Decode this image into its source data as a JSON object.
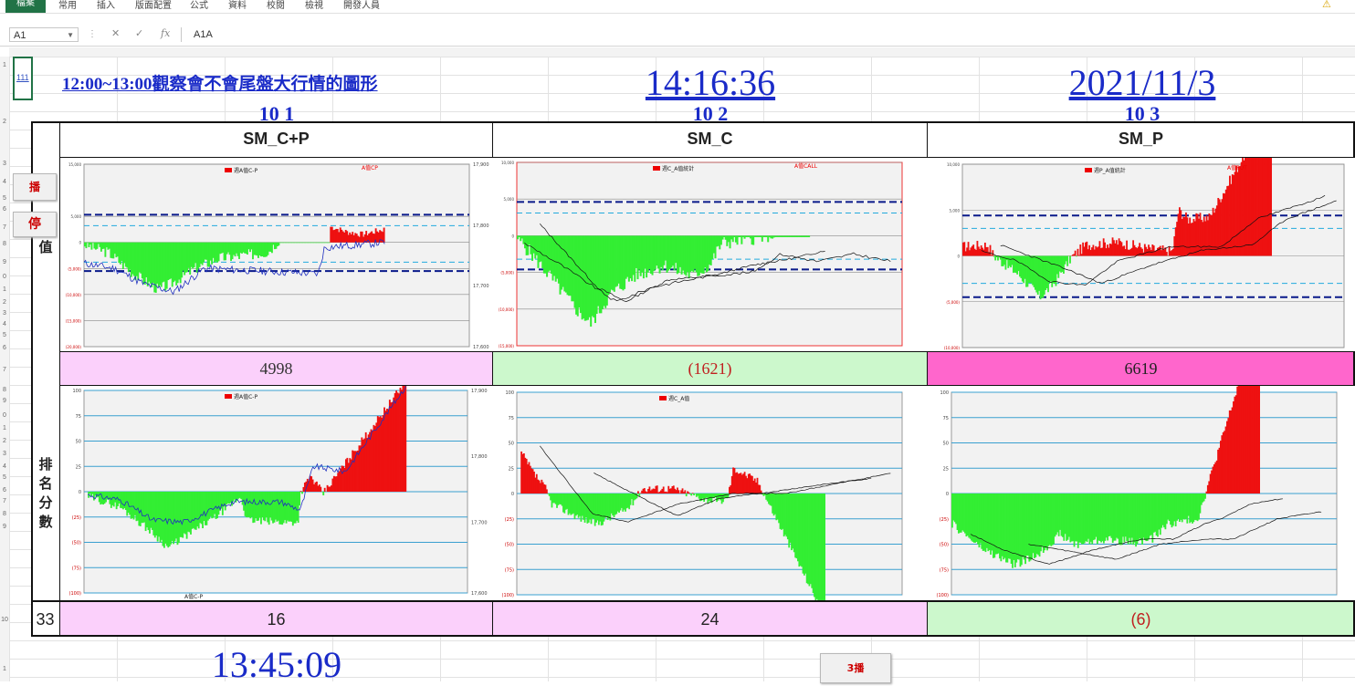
{
  "ribbon": {
    "tabs": [
      "檔案",
      "常用",
      "插入",
      "版面配置",
      "公式",
      "資料",
      "校閱",
      "檢視",
      "開發人員"
    ]
  },
  "formula_bar": {
    "name_box": "A1",
    "formula": "A1A"
  },
  "sheet": {
    "selected_cell_text": "111",
    "title": "12:00~13:00觀察會不會尾盤大行情的圖形",
    "time_top": "14:16:36",
    "date_top": "2021/11/3",
    "time_bottom": "13:45:09",
    "col_numbers": [
      "10 1",
      "10 2",
      "10 3"
    ],
    "headers": [
      "SM_C+P",
      "SM_C",
      "SM_P"
    ],
    "value_label": "值",
    "rank_label": "排名分數",
    "values": [
      "4998",
      "(1621)",
      "6619"
    ],
    "rank_index": "33",
    "ranks": [
      "16",
      "24",
      "(6)"
    ],
    "buttons": {
      "play": "播",
      "stop": "停",
      "play3": "3播"
    }
  },
  "colors": {
    "excel_green": "#217346",
    "link_blue": "#1a2bc8",
    "green_fill": "#33ee33",
    "red_fill": "#ee1111"
  },
  "charts": {
    "top": [
      {
        "legend": "週A值C-P",
        "tag": "A值CP",
        "left_ticks": [
          "15,000",
          "5,000",
          "0",
          "(5,000)",
          "(10,000)",
          "(15,000)",
          "(20,000)"
        ],
        "right_ticks": [
          "17,900",
          "17,800",
          "17,700",
          "17,600"
        ]
      },
      {
        "legend": "週C_A值統計",
        "tag": "A值CALL",
        "left_ticks": [
          "10,000",
          "5,000",
          "0",
          "(5,000)",
          "(10,000)",
          "(15,000)"
        ]
      },
      {
        "legend": "週P_A值統計",
        "tag": "A值PUT",
        "left_ticks": [
          "10,000",
          "5,000",
          "0",
          "(5,000)",
          "(10,000)"
        ]
      }
    ],
    "bottom": [
      {
        "legend": "週A值C-P",
        "xlabel": "A值C-P",
        "left_ticks": [
          "100",
          "75",
          "50",
          "25",
          "0",
          "(25)",
          "(50)",
          "(75)",
          "(100)"
        ],
        "right_ticks": [
          "17,900",
          "17,800",
          "17,700",
          "17,600"
        ]
      },
      {
        "legend": "週C_A值",
        "left_ticks": [
          "100",
          "75",
          "50",
          "25",
          "0",
          "(25)",
          "(50)",
          "(75)",
          "(100)"
        ]
      },
      {
        "left_ticks": [
          "100",
          "75",
          "50",
          "25",
          "0",
          "(25)",
          "(50)",
          "(75)",
          "(100)"
        ]
      }
    ]
  }
}
